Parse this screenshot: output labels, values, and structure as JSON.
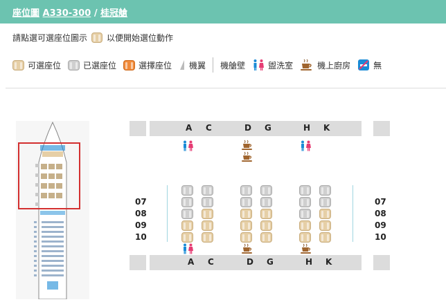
{
  "header": {
    "title_main": "座位圖",
    "aircraft": "A330-300",
    "separator": "/",
    "cabin": "桂冠艙"
  },
  "instruction": {
    "before": "請點選可選座位圖示",
    "after": "以便開始選位動作"
  },
  "legend": [
    {
      "key": "available",
      "label": "可選座位"
    },
    {
      "key": "occupied",
      "label": "已選座位"
    },
    {
      "key": "selected",
      "label": "選擇座位"
    },
    {
      "key": "wing",
      "label": "機翼"
    },
    {
      "key": "bulkhead",
      "label": "機艙壁"
    },
    {
      "key": "lavatory",
      "label": "盥洗室"
    },
    {
      "key": "galley",
      "label": "機上廚房"
    },
    {
      "key": "smoking",
      "label": "無"
    }
  ],
  "columns_top": [
    "A",
    "C",
    "D",
    "G",
    "H",
    "K"
  ],
  "columns_bottom": [
    "A",
    "C",
    "D",
    "G",
    "H",
    "K"
  ],
  "rows": [
    "07",
    "08",
    "09",
    "10"
  ],
  "seat_map": {
    "07": {
      "A": "occupied",
      "C": "occupied",
      "D": "occupied",
      "G": "occupied",
      "H": "occupied",
      "K": "occupied"
    },
    "08": {
      "A": "occupied",
      "C": "available",
      "D": "available",
      "G": "available",
      "H": "occupied",
      "K": "available"
    },
    "09": {
      "A": "available",
      "C": "available",
      "D": "available",
      "G": "available",
      "H": "available",
      "K": "available"
    },
    "10": {
      "A": "available",
      "C": "available",
      "D": "available",
      "G": "available",
      "H": "available",
      "K": "available"
    }
  },
  "colors": {
    "header": "#6cc3b0",
    "available": "#e6cfa6",
    "occupied": "#cfcfcf",
    "selected": "#f08a3a",
    "frame": "#d32f2f"
  }
}
